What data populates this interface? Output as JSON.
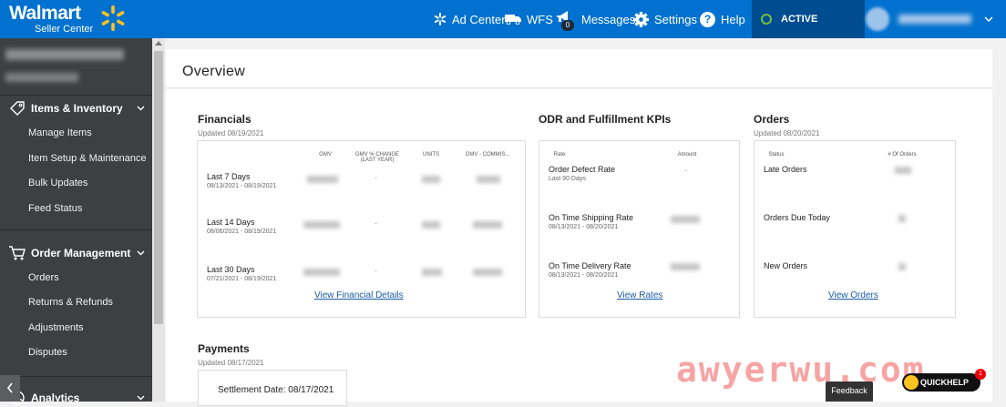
{
  "header": {
    "brand": "Walmart",
    "sub": "Seller Center",
    "nav": [
      {
        "label": "Ad Center",
        "icon": "spark-icon"
      },
      {
        "label": "WFS",
        "icon": "truck-icon"
      },
      {
        "label": "Messages",
        "icon": "megaphone-icon",
        "badge": "0"
      },
      {
        "label": "Settings",
        "icon": "gear-icon"
      },
      {
        "label": "Help",
        "icon": "help-icon"
      }
    ],
    "status": "ACTIVE"
  },
  "sidebar": {
    "sections": [
      {
        "label": "Items & Inventory",
        "items": [
          "Manage Items",
          "Item Setup & Maintenance",
          "Bulk Updates",
          "Feed Status"
        ]
      },
      {
        "label": "Order Management",
        "items": [
          "Orders",
          "Returns & Refunds",
          "Adjustments",
          "Disputes"
        ]
      },
      {
        "label": "Analytics",
        "items": []
      }
    ]
  },
  "page": {
    "title": "Overview"
  },
  "financials": {
    "title": "Financials",
    "updated": "Updated 08/19/2021",
    "columns": [
      "GMV",
      "GMV % CHANGE (LAST YEAR)",
      "Units",
      "GMV - COMMIS..."
    ],
    "rows": [
      {
        "label": "Last 7 Days",
        "range": "08/13/2021 - 08/19/2021",
        "change": "-"
      },
      {
        "label": "Last 14 Days",
        "range": "08/06/2021 - 08/19/2021",
        "change": "-"
      },
      {
        "label": "Last 30 Days",
        "range": "07/21/2021 - 08/19/2021",
        "change": "-"
      }
    ],
    "link": "View Financial Details"
  },
  "kpis": {
    "title": "ODR and Fulfillment KPIs",
    "columns": [
      "Rate",
      "Amount"
    ],
    "rows": [
      {
        "label": "Order Defect Rate",
        "range": "Last 90 Days",
        "amount": "-"
      },
      {
        "label": "On Time Shipping Rate",
        "range": "08/13/2021 - 08/20/2021"
      },
      {
        "label": "On Time Delivery Rate",
        "range": "08/13/2021 - 08/20/2021"
      }
    ],
    "link": "View Rates"
  },
  "orders": {
    "title": "Orders",
    "updated": "Updated 08/20/2021",
    "columns": [
      "Status",
      "# Of Orders"
    ],
    "rows": [
      {
        "label": "Late Orders"
      },
      {
        "label": "Orders Due Today"
      },
      {
        "label": "New Orders"
      }
    ],
    "link": "View Orders"
  },
  "payments": {
    "title": "Payments",
    "updated": "Updated 08/17/2021",
    "settlement": "Settlement Date: 08/17/2021"
  },
  "overlay": {
    "watermark": "awyerwu.com",
    "feedback": "Feedback",
    "quickhelp": "QUICKHELP",
    "quickhelp_badge": "1"
  },
  "colors": {
    "brand": "#0071ce",
    "spark": "#ffc220",
    "sidebar": "#3d3f43",
    "link": "#1a5aa8"
  }
}
